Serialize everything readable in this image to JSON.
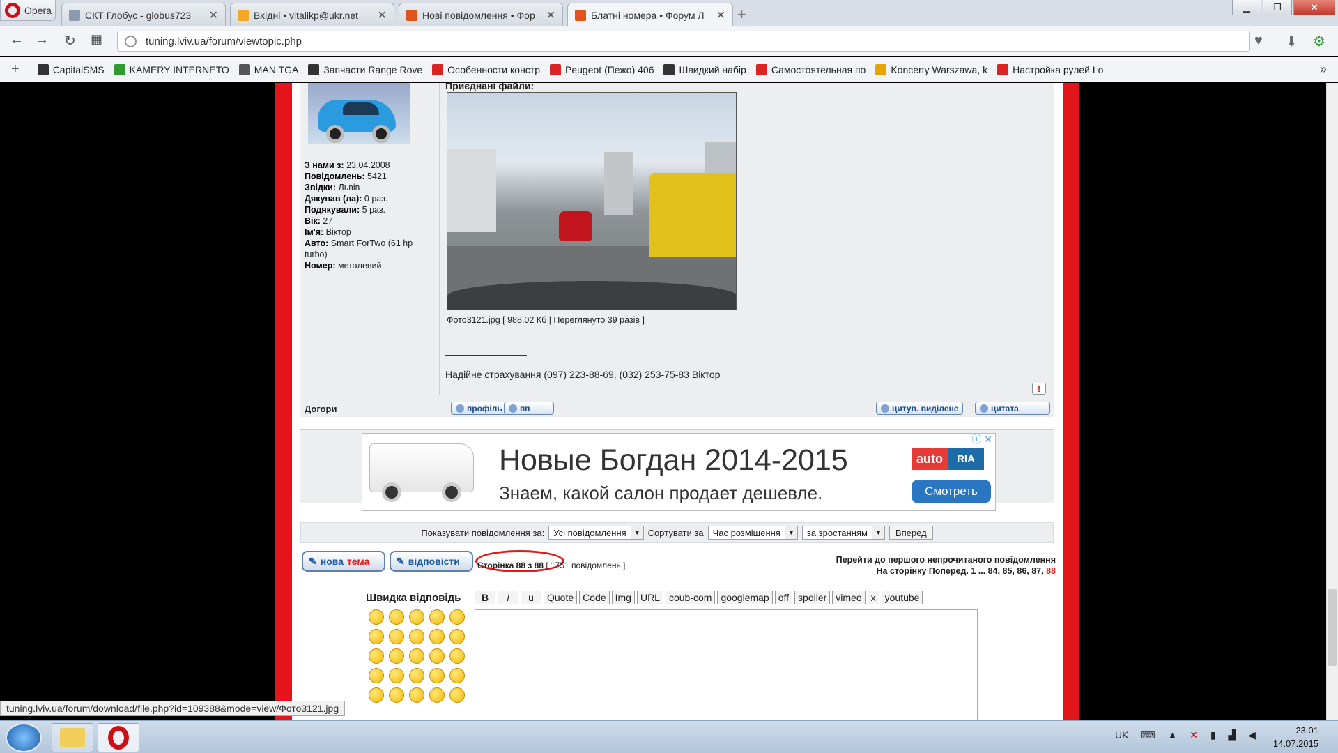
{
  "browser": {
    "menu_label": "Opera",
    "tabs": [
      {
        "label": "СКТ Глобус - globus723",
        "color": "#8a9bb0"
      },
      {
        "label": "Вхідні • vitalikp@ukr.net",
        "color": "#f5a623"
      },
      {
        "label": "Нові повідомлення • Фор",
        "color": "#e0531c"
      },
      {
        "label": "Блатні номера • Форум Л",
        "color": "#e0531c"
      }
    ],
    "url": "tuning.lviv.ua/forum/viewtopic.php",
    "bookmarks": [
      {
        "label": "CapitalSMS",
        "color": "#333"
      },
      {
        "label": "KAMERY INTERNETO",
        "color": "#2e9b2e"
      },
      {
        "label": "MAN TGA",
        "color": "#555"
      },
      {
        "label": "Запчасти Range Rove",
        "color": "#333"
      },
      {
        "label": "Особенности констр",
        "color": "#d22"
      },
      {
        "label": "Peugeot (Пежо) 406",
        "color": "#d22"
      },
      {
        "label": "Швидкий набір",
        "color": "#333"
      },
      {
        "label": "Самостоятельная по",
        "color": "#d22"
      },
      {
        "label": "Koncerty Warszawa, k",
        "color": "#e5a500"
      },
      {
        "label": "Настройка рулей Lo",
        "color": "#d22"
      }
    ]
  },
  "post": {
    "profile": {
      "joined_label": "З нами з:",
      "joined": "23.04.2008",
      "posts_label": "Повідомлень:",
      "posts": "5421",
      "from_label": "Звідки:",
      "from": "Львів",
      "thanked_label": "Дякував (ла):",
      "thanked": "0 раз.",
      "thanks_label": "Подякували:",
      "thanks": "5 раз.",
      "age_label": "Вік:",
      "age": "27",
      "name_label": "Ім'я:",
      "name": "Віктор",
      "car_label": "Авто:",
      "car": "Smart ForTwo (61 hp turbo)",
      "plate_label": "Номер:",
      "plate": "металевий"
    },
    "attachments_title": "Приєднані файли:",
    "caption": "Фото3121.jpg [ 988.02 Кб | Переглянуто 39 разів ]",
    "signature_line": "_______________",
    "signature": "Надійне страхування (097) 223-88-69, (032) 253-75-83 Віктор",
    "report_icon": "!",
    "go_top": "Догори",
    "buttons": {
      "profile": "профіль",
      "pm": "пп",
      "quote_sel": "цитув. виділене",
      "quote": "цитата"
    }
  },
  "ad": {
    "headline": "Новые Богдан 2014-2015",
    "subline": "Знаем, какой салон продает дешевле.",
    "logo_auto": "auto",
    "logo_ria": "RIA",
    "button": "Смотреть",
    "info_icons": "ⓘ ✕"
  },
  "sort": {
    "show_label": "Показувати повідомлення за:",
    "show_value": "Усі повідомлення",
    "sort_label": "Сортувати за",
    "sort_value": "Час розміщення",
    "order_value": "за зростанням",
    "go": "Вперед"
  },
  "pagination": {
    "new_topic_1": "нова",
    "new_topic_2": "тема",
    "reply": "відповісти",
    "page_info": "Сторінка 88 з 88",
    "posts_count": "[ 1751 повідомлень ]",
    "jump_unread": "Перейти до першого непрочитаного повідомлення",
    "goto_page": "На сторінку Поперед.  1 ... 84, 85, 86, 87,",
    "current_page": "88"
  },
  "quick_reply": {
    "title": "Швидка відповідь",
    "toolbar": [
      "B",
      "i",
      "u",
      "Quote",
      "Code",
      "Img",
      "URL",
      "coub-com",
      "googlemap",
      "off",
      "spoiler",
      "vimeo",
      "x",
      "youtube"
    ]
  },
  "status_url": "tuning.lviv.ua/forum/download/file.php?id=109388&mode=view/Фото3121.jpg",
  "taskbar": {
    "lang": "UK",
    "time": "23:01",
    "date": "14.07.2015"
  }
}
